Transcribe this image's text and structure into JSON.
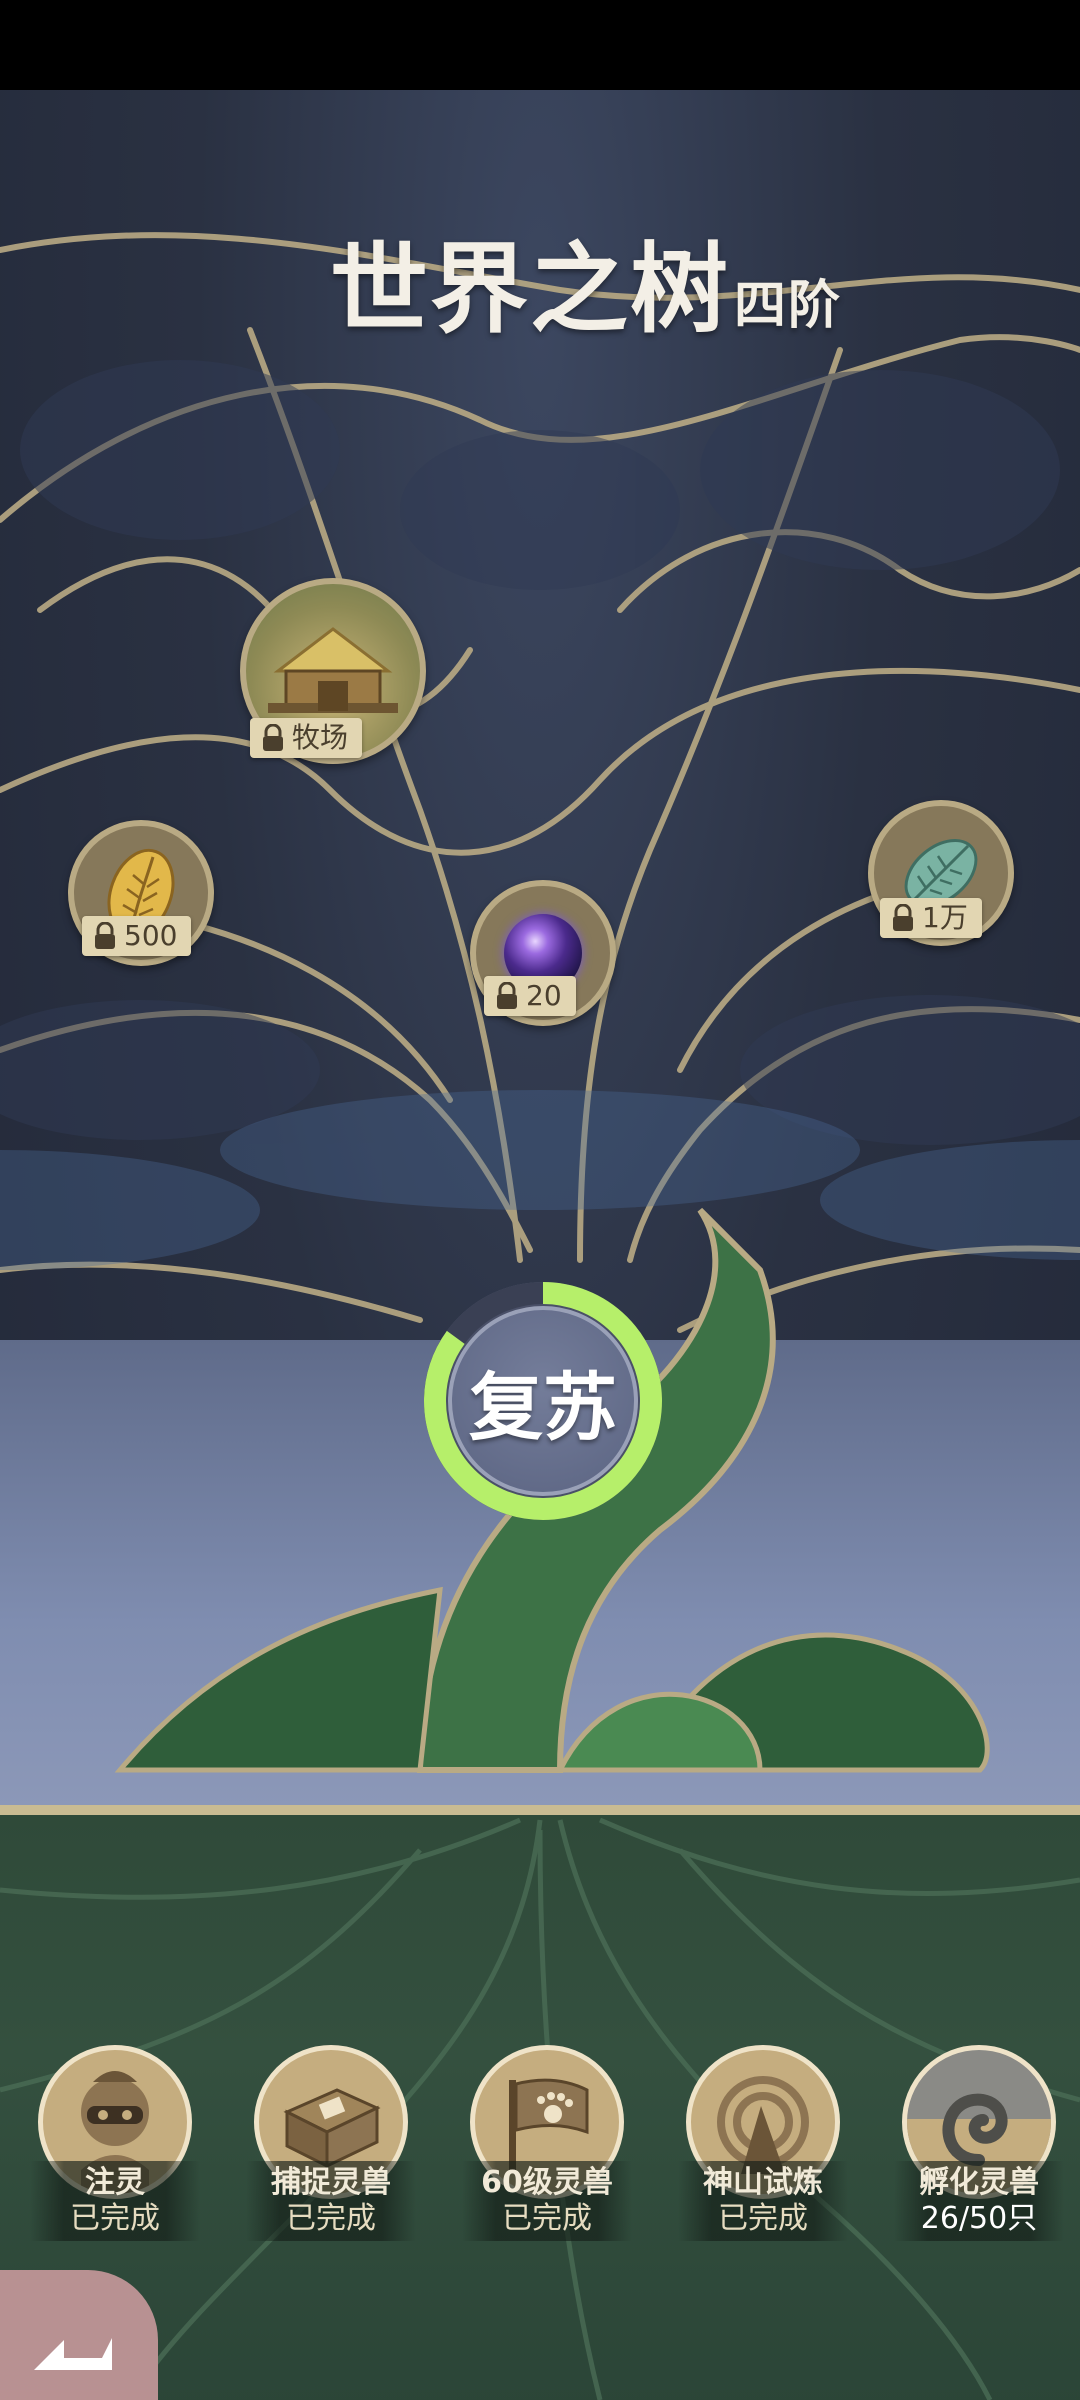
{
  "title": {
    "main": "世界之树",
    "sub": "四阶"
  },
  "nodes": {
    "ranch": {
      "label": "牧场",
      "icon": "ranch-scene-icon",
      "locked": true
    },
    "gold_seed": {
      "label": "500",
      "icon": "gold-leaf-seed-icon",
      "locked": true
    },
    "orb": {
      "label": "20",
      "icon": "purple-galaxy-orb-icon",
      "locked": true
    },
    "jade_seed": {
      "label": "1万",
      "icon": "jade-leaf-seed-icon",
      "locked": true
    }
  },
  "revive": {
    "label": "复苏",
    "progress": 0.85,
    "ring_color": "#b6ef6a"
  },
  "tasks": [
    {
      "name": "注灵",
      "status": "已完成",
      "icon": "masked-spirit-icon"
    },
    {
      "name": "捕捉灵兽",
      "status": "已完成",
      "icon": "capture-box-icon"
    },
    {
      "name": "60级灵兽",
      "status": "已完成",
      "icon": "paw-flag-icon"
    },
    {
      "name": "神山试炼",
      "status": "已完成",
      "icon": "mountain-trial-icon"
    },
    {
      "name": "孵化灵兽",
      "status": "26/50只",
      "icon": "hatch-spiral-icon",
      "progress": 0.52
    }
  ],
  "colors": {
    "accent": "#b6ef6a",
    "tree_outline": "#b9aa84",
    "ground": "#2f4a39"
  }
}
